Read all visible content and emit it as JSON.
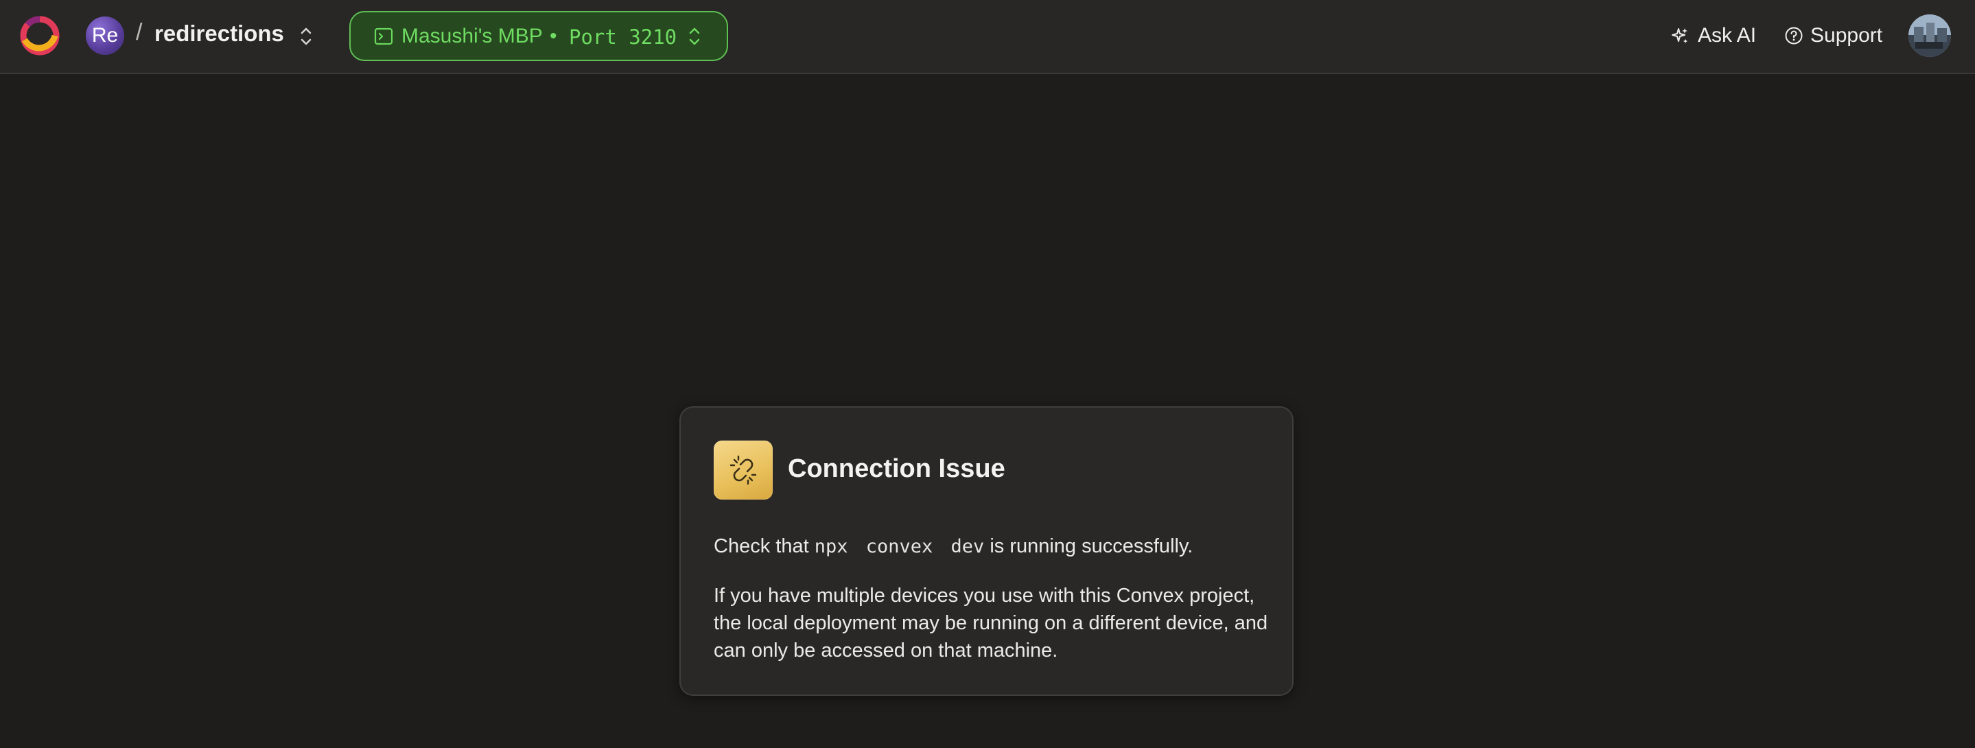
{
  "header": {
    "team_initials": "Re",
    "separator": "/",
    "project_name": "redirections",
    "deployment": {
      "device": "Masushi's MBP",
      "separator": "•",
      "port_label": "Port 3210"
    },
    "ask_ai_label": "Ask AI",
    "support_label": "Support"
  },
  "card": {
    "title": "Connection Issue",
    "p1_before": "Check that ",
    "p1_code": "npx convex dev",
    "p1_after": " is running successfully.",
    "p2": "If you have multiple devices you use with this Convex project, the local deployment may be running on a different device, and can only be accessed on that machine."
  },
  "colors": {
    "background": "#1e1d1b",
    "topbar": "#282725",
    "deployment_accent": "#5fbf52",
    "warning_icon": "#e8bf5a"
  },
  "icons": {
    "logo": "convex-logo-icon",
    "project_switch": "chevron-up-down-icon",
    "terminal": "terminal-icon",
    "ask_ai": "sparkles-icon",
    "support": "question-circle-icon",
    "connection": "broken-link-icon"
  }
}
